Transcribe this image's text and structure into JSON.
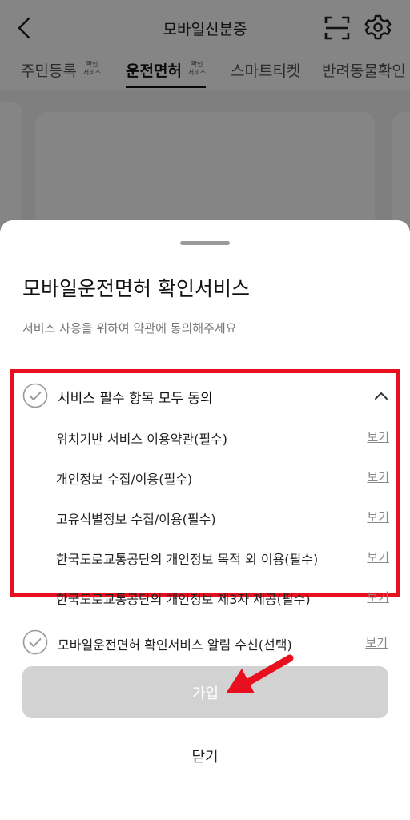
{
  "header": {
    "title": "모바일신분증",
    "back_icon": "chevron-left-icon",
    "scan_icon": "scan-frame-icon",
    "settings_icon": "gear-icon"
  },
  "tabs": [
    {
      "label": "주민등록",
      "badge_line1": "확인",
      "badge_line2": "서비스",
      "active": false
    },
    {
      "label": "운전면허",
      "badge_line1": "확인",
      "badge_line2": "서비스",
      "active": true
    },
    {
      "label": "스마트티켓",
      "active": false
    },
    {
      "label": "반려동물확인",
      "active": false
    }
  ],
  "sheet": {
    "title": "모바일운전면허 확인서비스",
    "subtitle": "서비스 사용을 위하여 약관에 동의해주세요",
    "agree_all_label": "서비스 필수 항목 모두 동의",
    "terms": [
      {
        "label": "위치기반 서비스 이용약관(필수)",
        "view": "보기"
      },
      {
        "label": "개인정보 수집/이용(필수)",
        "view": "보기"
      },
      {
        "label": "고유식별정보 수집/이용(필수)",
        "view": "보기"
      },
      {
        "label": "한국도로교통공단의 개인정보 목적 외 이용(필수)",
        "view": "보기"
      },
      {
        "label": "한국도로교통공단의 개인정보 제3자 제공(필수)",
        "view": "보기"
      }
    ],
    "optional": {
      "label": "모바일운전면허 확인서비스 알림 수신(선택)",
      "view": "보기"
    },
    "join_label": "가입",
    "close_label": "닫기"
  },
  "colors": {
    "highlight": "#e8101e",
    "arrow": "#e8101e",
    "button_disabled": "#d2d2d2"
  }
}
